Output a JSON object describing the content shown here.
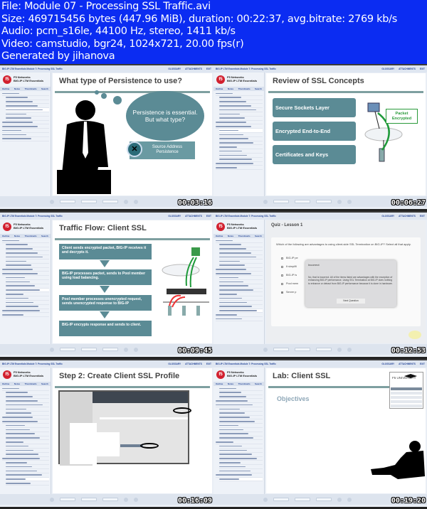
{
  "header": {
    "lines": [
      "File: Module 07 - Processing SSL Traffic.avi",
      "Size: 469715456 bytes (447.96 MiB), duration: 00:22:37, avg.bitrate: 2769 kb/s",
      "Audio: pcm_s16le, 44100 Hz, stereo, 1411 kb/s",
      "Video: camstudio, bgr24, 1024x721, 20.00 fps(r)",
      "Generated by jihanova"
    ]
  },
  "player": {
    "course_title": "BIG-IP LTM Essentials Module 7: Processing SSL Traffic",
    "links": [
      "GLOSSARY",
      "ATTACHMENTS",
      "EXIT"
    ],
    "logo_line1": "F5 Networks",
    "logo_line2": "BIG-IP LTM Essentials",
    "tabs": [
      "Outline",
      "Notes",
      "Thumbnails",
      "Search"
    ]
  },
  "thumbs": [
    {
      "time": "00:03:16",
      "title": "What type of Persistence to use?",
      "bubble": "Persistence is essential. But what type?",
      "option": "Source Address Persistence"
    },
    {
      "time": "00:06:27",
      "title": "Review of SSL Concepts",
      "boxes": [
        "Secure Sockets Layer",
        "Encrypted End-to-End",
        "Certificates and Keys"
      ],
      "callout": "Packet Encrypted"
    },
    {
      "time": "00:09:45",
      "title": "Traffic Flow:  Client SSL",
      "boxes": [
        "Client sends encrypted packet, BIG-IP receives it and decrypts it.",
        "BIG-IP processes packet, sends to Pool member using load balancing.",
        "Pool member processes unencrypted request, sends unencrypted response to BIG-IP",
        "BIG-IP encrypts response and sends to client."
      ]
    },
    {
      "time": "00:12:53",
      "title": "Quiz - Lesson 1",
      "question": "Which of the following are advantages to using client-side SSL Termination on BIG-IP? Select all that apply.",
      "options": [
        "BIG-IP pe",
        "It simplifi",
        "BIG-IP is",
        "Pool mem",
        "Server p"
      ],
      "dialog_title": "Incorrect",
      "dialog_text": "No, that is incorrect. All of the items listed are advantages with the exception of enhancing BIG-IP performance.  Using SSL Termination at BIG-IP does nothing to enhance or detract from BIG-IP performance because it is done in hardware.",
      "dialog_button": "Next Question"
    },
    {
      "time": "00:16:09",
      "title": "Step 2:  Create Client SSL Profile"
    },
    {
      "time": "00:19:20",
      "title": "Lab:  Client SSL",
      "subtitle": "Objectives",
      "brand": "F5 UNIVERSITY"
    }
  ]
}
